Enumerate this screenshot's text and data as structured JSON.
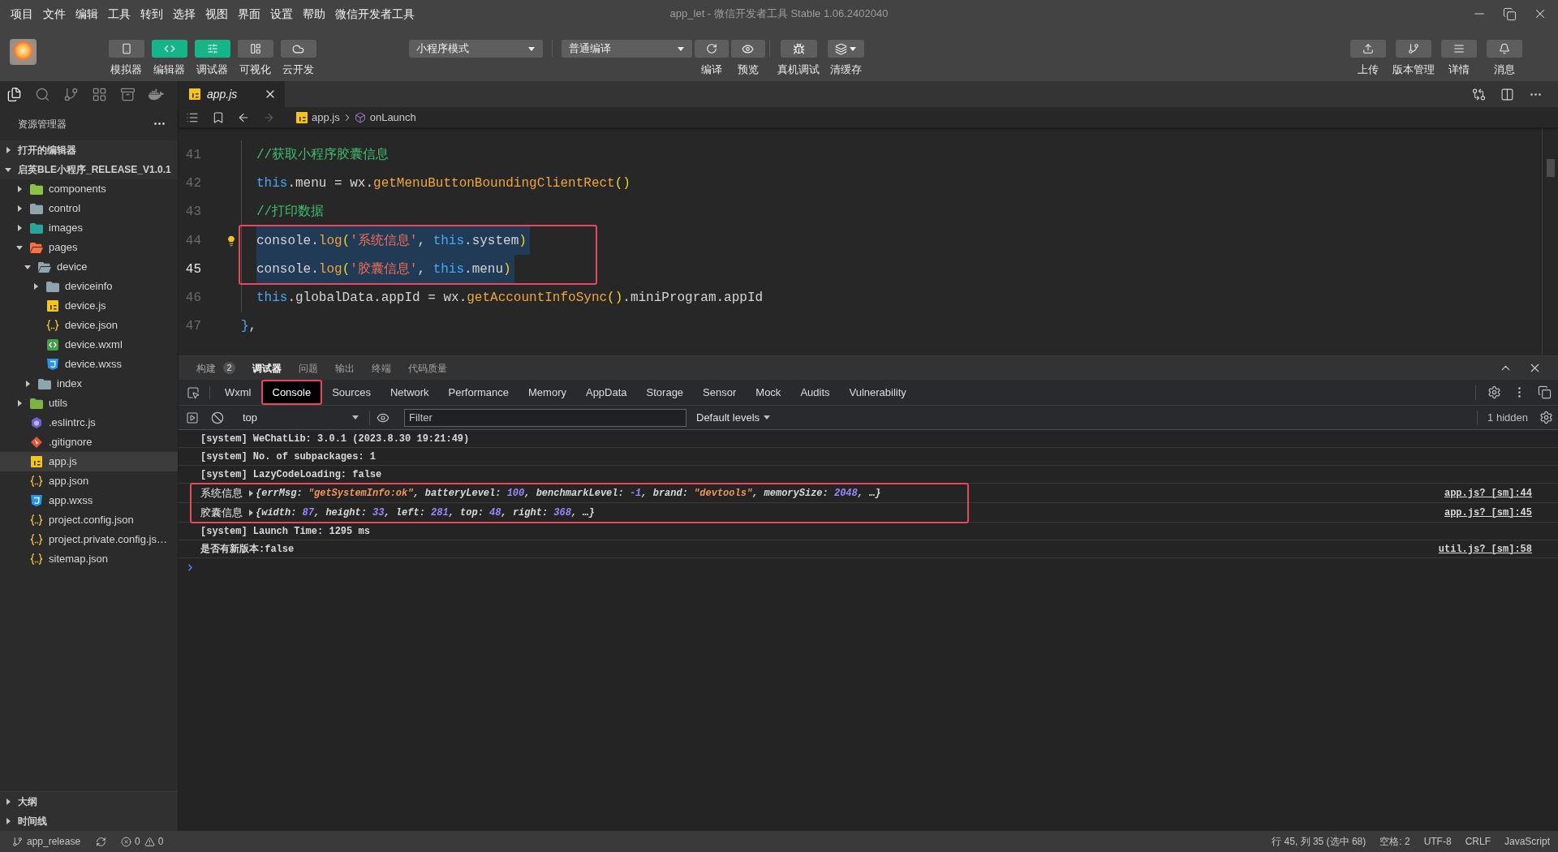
{
  "menu_bar": {
    "items": [
      "项目",
      "文件",
      "编辑",
      "工具",
      "转到",
      "选择",
      "视图",
      "界面",
      "设置",
      "帮助",
      "微信开发者工具"
    ],
    "title": "app_let - 微信开发者工具 Stable 1.06.2402040"
  },
  "toolbar": {
    "left_buttons": [
      {
        "label": "模拟器",
        "kind": "simulator",
        "on": false
      },
      {
        "label": "编辑器",
        "kind": "editor",
        "on": true
      },
      {
        "label": "调试器",
        "kind": "debugger",
        "on": true
      },
      {
        "label": "可视化",
        "kind": "visual",
        "on": false
      },
      {
        "label": "云开发",
        "kind": "cloud",
        "on": false
      }
    ],
    "mode_select": {
      "value": "小程序模式"
    },
    "compile_select": {
      "value": "普通编译"
    },
    "compile_buttons": [
      {
        "label": "编译",
        "kind": "compile"
      },
      {
        "label": "预览",
        "kind": "preview"
      }
    ],
    "debug_buttons": [
      {
        "label": "真机调试",
        "kind": "device"
      },
      {
        "label": "清缓存",
        "kind": "cache"
      }
    ],
    "right_buttons": [
      {
        "label": "上传",
        "kind": "upload"
      },
      {
        "label": "版本管理",
        "kind": "version"
      },
      {
        "label": "详情",
        "kind": "details"
      },
      {
        "label": "消息",
        "kind": "messages"
      }
    ]
  },
  "sidebar": {
    "activity_bar": [
      {
        "kind": "explorer",
        "selected": true
      },
      {
        "kind": "search",
        "selected": false
      },
      {
        "kind": "source_control",
        "selected": false
      },
      {
        "kind": "extensions",
        "selected": false
      },
      {
        "kind": "storage",
        "selected": false
      },
      {
        "kind": "docker",
        "selected": false
      }
    ],
    "title": "资源管理器",
    "sections": [
      {
        "label": "打开的编辑器",
        "expanded": false
      },
      {
        "label": "启英BLE小程序_RELEASE_V1.0.1",
        "expanded": true,
        "children": [
          {
            "name": "components",
            "kind": "folder",
            "color": "#8dc149",
            "expanded": false,
            "selected": false
          },
          {
            "name": "control",
            "kind": "folder",
            "color": "#90a4ae",
            "expanded": false,
            "selected": false
          },
          {
            "name": "images",
            "kind": "folder",
            "color": "#26a69a",
            "expanded": false,
            "selected": false
          },
          {
            "name": "pages",
            "kind": "folder",
            "color": "#ff7043",
            "expanded": true,
            "selected": false,
            "children": [
              {
                "name": "device",
                "kind": "folder",
                "color": "#90a4ae",
                "expanded": true,
                "selected": false,
                "children": [
                  {
                    "name": "deviceinfo",
                    "kind": "folder",
                    "color": "#90a4ae",
                    "expanded": false,
                    "selected": false
                  },
                  {
                    "name": "device.js",
                    "kind": "js",
                    "selected": false
                  },
                  {
                    "name": "device.json",
                    "kind": "json",
                    "selected": false
                  },
                  {
                    "name": "device.wxml",
                    "kind": "wxml",
                    "selected": false
                  },
                  {
                    "name": "device.wxss",
                    "kind": "wxss",
                    "selected": false
                  }
                ]
              },
              {
                "name": "index",
                "kind": "folder",
                "color": "#90a4ae",
                "expanded": false,
                "selected": false
              }
            ]
          },
          {
            "name": "utils",
            "kind": "folder",
            "color": "#7cb342",
            "expanded": false,
            "selected": false
          },
          {
            "name": ".eslintrc.js",
            "kind": "eslint",
            "selected": false
          },
          {
            "name": ".gitignore",
            "kind": "git",
            "selected": false
          },
          {
            "name": "app.js",
            "kind": "js",
            "selected": true
          },
          {
            "name": "app.json",
            "kind": "json",
            "selected": false
          },
          {
            "name": "app.wxss",
            "kind": "wxss",
            "selected": false
          },
          {
            "name": "project.config.json",
            "kind": "json",
            "selected": false
          },
          {
            "name": "project.private.config.js…",
            "kind": "json",
            "selected": false
          },
          {
            "name": "sitemap.json",
            "kind": "json",
            "selected": false
          }
        ]
      }
    ],
    "bottom_sections": [
      {
        "label": "大纲",
        "expanded": false
      },
      {
        "label": "时间线",
        "expanded": false
      }
    ]
  },
  "editor": {
    "tabs": [
      {
        "label": "app.js",
        "kind": "js",
        "selected": true,
        "preview": true
      }
    ],
    "navigation": [
      {
        "kind": "back",
        "disabled": false
      },
      {
        "kind": "forward",
        "disabled": true
      }
    ],
    "breadcrumb": [
      {
        "label": "app.js",
        "kind": "file"
      },
      {
        "label": "onLaunch",
        "kind": "method"
      }
    ],
    "lines": [
      {
        "number": "41",
        "nested": true,
        "selected": false,
        "current": false,
        "highlighted": false,
        "hint": false,
        "tokens": [
          {
            "text": "//获取小程序胶囊信息",
            "kind": "comment"
          }
        ]
      },
      {
        "number": "42",
        "nested": true,
        "selected": false,
        "current": false,
        "highlighted": false,
        "hint": false,
        "tokens": [
          {
            "text": "this",
            "kind": "keyword"
          },
          {
            "text": ".menu = wx.",
            "kind": "plain"
          },
          {
            "text": "getMenuButtonBoundingClientRect",
            "kind": "function"
          },
          {
            "text": "()",
            "kind": "bracket"
          }
        ]
      },
      {
        "number": "43",
        "nested": true,
        "selected": false,
        "current": false,
        "highlighted": false,
        "hint": false,
        "tokens": [
          {
            "text": "//打印数据",
            "kind": "comment"
          }
        ]
      },
      {
        "number": "44",
        "nested": true,
        "selected": true,
        "current": false,
        "highlighted": true,
        "hint": true,
        "tokens": [
          {
            "text": "console.",
            "kind": "plain"
          },
          {
            "text": "log",
            "kind": "function"
          },
          {
            "text": "(",
            "kind": "bracket"
          },
          {
            "text": "'系统信息'",
            "kind": "string"
          },
          {
            "text": ", ",
            "kind": "plain"
          },
          {
            "text": "this",
            "kind": "keyword"
          },
          {
            "text": ".system",
            "kind": "plain"
          },
          {
            "text": ")",
            "kind": "bracket"
          }
        ]
      },
      {
        "number": "45",
        "nested": true,
        "selected": true,
        "current": true,
        "highlighted": true,
        "hint": false,
        "tokens": [
          {
            "text": "console.",
            "kind": "plain"
          },
          {
            "text": "log",
            "kind": "function"
          },
          {
            "text": "(",
            "kind": "bracket"
          },
          {
            "text": "'胶囊信息'",
            "kind": "string"
          },
          {
            "text": ", ",
            "kind": "plain"
          },
          {
            "text": "this",
            "kind": "keyword"
          },
          {
            "text": ".menu",
            "kind": "plain"
          },
          {
            "text": ")",
            "kind": "bracket"
          }
        ]
      },
      {
        "number": "46",
        "nested": true,
        "selected": false,
        "current": false,
        "highlighted": false,
        "hint": false,
        "tokens": [
          {
            "text": "this",
            "kind": "keyword"
          },
          {
            "text": ".globalData.appId = wx.",
            "kind": "plain"
          },
          {
            "text": "getAccountInfoSync",
            "kind": "function"
          },
          {
            "text": "()",
            "kind": "bracket"
          },
          {
            "text": ".miniProgram.appId",
            "kind": "plain"
          }
        ]
      },
      {
        "number": "47",
        "nested": false,
        "selected": false,
        "current": false,
        "highlighted": false,
        "hint": false,
        "tokens": [
          {
            "text": "}",
            "kind": "bracket_outer"
          },
          {
            "text": ",",
            "kind": "plain"
          }
        ]
      }
    ]
  },
  "panel": {
    "tabs": [
      {
        "label": "构建",
        "badge": "2",
        "selected": false
      },
      {
        "label": "调试器",
        "selected": true
      },
      {
        "label": "问题",
        "selected": false
      },
      {
        "label": "输出",
        "selected": false
      },
      {
        "label": "终端",
        "selected": false
      },
      {
        "label": "代码质量",
        "selected": false
      }
    ]
  },
  "devtools": {
    "tabs": [
      {
        "label": "Wxml",
        "selected": false,
        "highlighted": false
      },
      {
        "label": "Console",
        "selected": true,
        "highlighted": true
      },
      {
        "label": "Sources",
        "selected": false,
        "highlighted": false
      },
      {
        "label": "Network",
        "selected": false,
        "highlighted": false
      },
      {
        "label": "Performance",
        "selected": false,
        "highlighted": false
      },
      {
        "label": "Memory",
        "selected": false,
        "highlighted": false
      },
      {
        "label": "AppData",
        "selected": false,
        "highlighted": false
      },
      {
        "label": "Storage",
        "selected": false,
        "highlighted": false
      },
      {
        "label": "Sensor",
        "selected": false,
        "highlighted": false
      },
      {
        "label": "Mock",
        "selected": false,
        "highlighted": false
      },
      {
        "label": "Audits",
        "selected": false,
        "highlighted": false
      },
      {
        "label": "Vulnerability",
        "selected": false,
        "highlighted": false
      }
    ],
    "context": "top",
    "filter": {
      "placeholder": "Filter"
    },
    "levels": "Default levels",
    "hidden": "1 hidden"
  },
  "console": {
    "messages": [
      {
        "kind": "text",
        "text": "[system] WeChatLib: 3.0.1 (2023.8.30 19:21:49)",
        "highlighted": false
      },
      {
        "kind": "text",
        "text": "[system] No. of subpackages: 1",
        "highlighted": false
      },
      {
        "kind": "text",
        "text": "[system] LazyCodeLoading: false",
        "highlighted": false
      },
      {
        "kind": "object",
        "label": "系统信息",
        "expanded": false,
        "tokens": [
          {
            "text": "{errMsg: ",
            "kind": "key"
          },
          {
            "text": "\"getSystemInfo:ok\"",
            "kind": "string"
          },
          {
            "text": ", batteryLevel: ",
            "kind": "key"
          },
          {
            "text": "100",
            "kind": "number"
          },
          {
            "text": ", benchmarkLevel: ",
            "kind": "key"
          },
          {
            "text": "-1",
            "kind": "number"
          },
          {
            "text": ", brand: ",
            "kind": "key"
          },
          {
            "text": "\"devtools\"",
            "kind": "string"
          },
          {
            "text": ", memorySize: ",
            "kind": "key"
          },
          {
            "text": "2048",
            "kind": "number"
          },
          {
            "text": ", …}",
            "kind": "key"
          }
        ],
        "source": "app.js? [sm]:44",
        "highlighted": true
      },
      {
        "kind": "object",
        "label": "胶囊信息",
        "expanded": false,
        "tokens": [
          {
            "text": "{width: ",
            "kind": "key"
          },
          {
            "text": "87",
            "kind": "number"
          },
          {
            "text": ", height: ",
            "kind": "key"
          },
          {
            "text": "33",
            "kind": "number"
          },
          {
            "text": ", left: ",
            "kind": "key"
          },
          {
            "text": "281",
            "kind": "number"
          },
          {
            "text": ", top: ",
            "kind": "key"
          },
          {
            "text": "48",
            "kind": "number"
          },
          {
            "text": ", right: ",
            "kind": "key"
          },
          {
            "text": "368",
            "kind": "number"
          },
          {
            "text": ", …}",
            "kind": "key"
          }
        ],
        "source": "app.js? [sm]:45",
        "highlighted": true
      },
      {
        "kind": "text",
        "text": "[system] Launch Time: 1295 ms",
        "highlighted": false
      },
      {
        "kind": "text",
        "text": "是否有新版本:false",
        "source": "util.js? [sm]:58",
        "highlighted": false
      }
    ]
  },
  "status_bar": {
    "branch": "app_release",
    "errors": "0",
    "warnings": "0",
    "items": [
      "行 45, 列 35 (选中 68)",
      "空格: 2",
      "UTF-8",
      "CRLF",
      "JavaScript"
    ]
  }
}
